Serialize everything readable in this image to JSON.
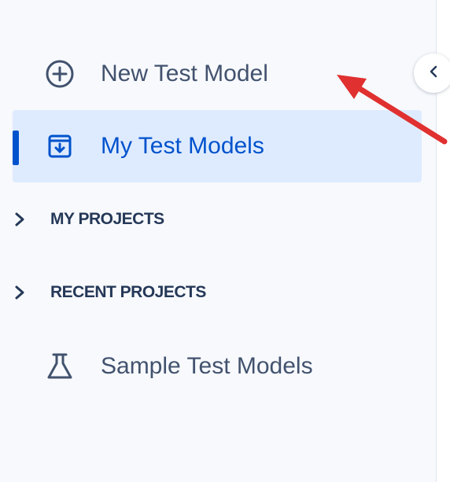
{
  "sidebar": {
    "new_test_model": {
      "label": "New Test Model",
      "icon": "plus-circle-icon"
    },
    "my_test_models": {
      "label": "My Test Models",
      "icon": "archive-download-icon",
      "active": true
    },
    "sections": [
      {
        "title": "MY PROJECTS",
        "expanded": false
      },
      {
        "title": "RECENT PROJECTS",
        "expanded": false
      }
    ],
    "sample_test_models": {
      "label": "Sample Test Models",
      "icon": "flask-icon"
    },
    "collapse_button": {
      "icon": "chevron-left-icon"
    }
  },
  "annotation": {
    "type": "red-arrow",
    "color": "#e03030",
    "points_to": "New Test Model"
  },
  "colors": {
    "accent": "#0052cc",
    "active_bg": "#deebff",
    "text": "#42526e",
    "sidebar_bg": "#f7f9fc"
  }
}
